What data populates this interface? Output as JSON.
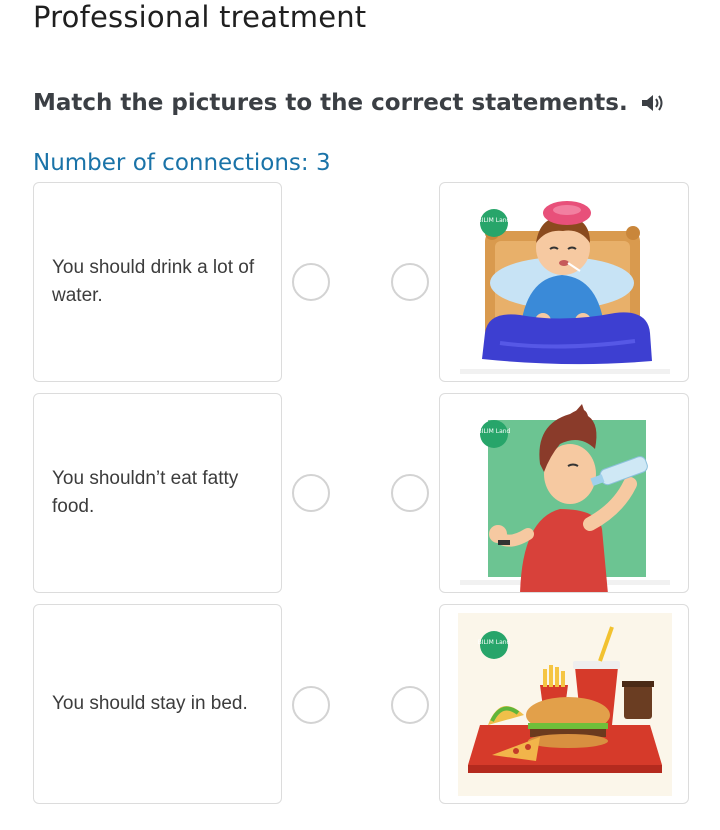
{
  "page": {
    "title": "Professional treatment"
  },
  "task": {
    "instruction": "Match the pictures to the correct statements.",
    "speaker_icon": "speaker-icon"
  },
  "counter": {
    "label": "Number of connections: 3"
  },
  "statements": [
    {
      "text": "You should drink a lot of water."
    },
    {
      "text": "You shouldn’t eat fatty food."
    },
    {
      "text": "You should stay in bed."
    }
  ],
  "pictures": [
    {
      "subject": "sick boy in bed with ice pack",
      "logo": "BILIM Land"
    },
    {
      "subject": "boy drinking water from bottle",
      "logo": "BILIM Land"
    },
    {
      "subject": "tray of fast food",
      "logo": "BILIM Land"
    }
  ],
  "colors": {
    "accent": "#1a73a8",
    "logo_green": "#27a56a",
    "radio_border": "#d3d3d3"
  }
}
